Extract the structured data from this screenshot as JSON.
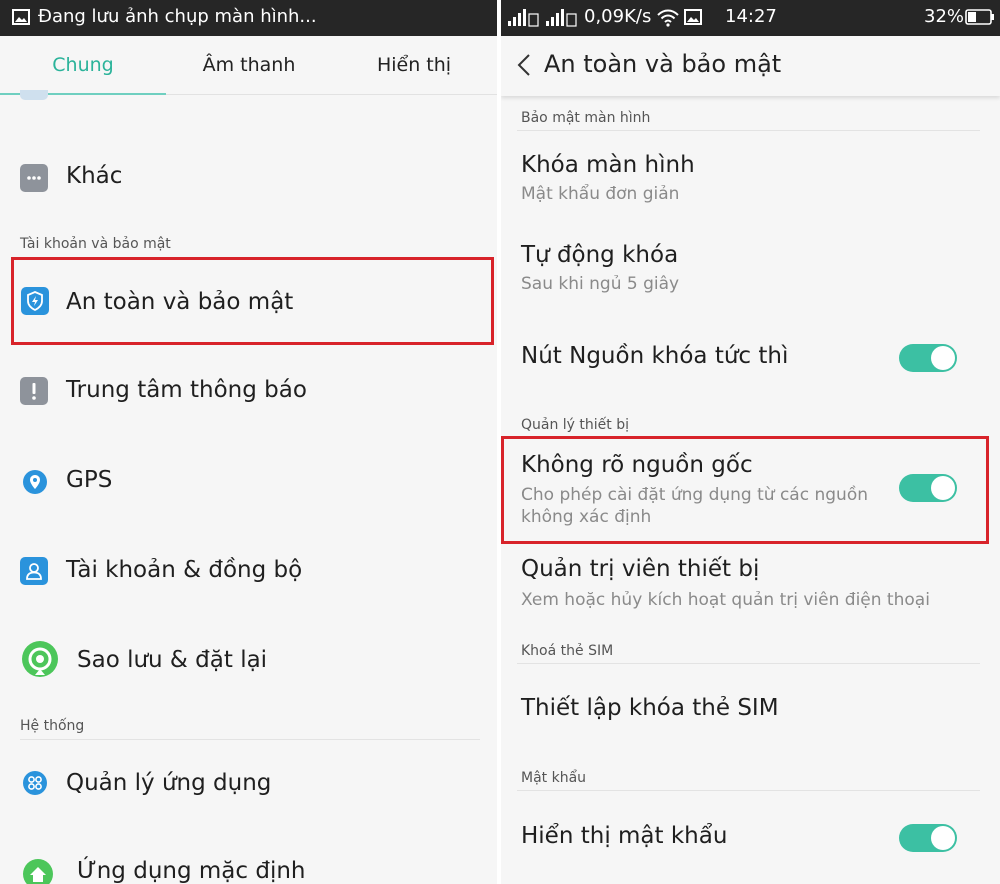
{
  "left_screen": {
    "status_title": "Đang lưu ảnh chụp màn hình...",
    "tabs": [
      "Chung",
      "Âm thanh",
      "Hiển thị"
    ],
    "items": {
      "other": "Khác",
      "security": "An toàn và bảo mật",
      "notification_center": "Trung tâm thông báo",
      "gps": "GPS",
      "accounts_sync": "Tài khoản & đồng bộ",
      "backup_reset": "Sao lưu & đặt lại",
      "app_manager": "Quản lý ứng dụng",
      "default_apps": "Ứng dụng mặc định"
    },
    "sections": {
      "account_security": "Tài khoản và bảo mật",
      "system": "Hệ thống"
    },
    "colors": {
      "accent": "#2bb39a",
      "highlight": "#d8232a"
    }
  },
  "right_screen": {
    "status": {
      "network_speed": "0,09K/s",
      "time": "14:27",
      "battery": "32%"
    },
    "header_title": "An toàn và bảo mật",
    "sections": {
      "screen_security": "Bảo mật màn hình",
      "device_management": "Quản lý thiết bị",
      "sim_lock": "Khoá thẻ SIM",
      "password": "Mật khẩu"
    },
    "rows": {
      "screen_lock": {
        "title": "Khóa màn hình",
        "subtitle": "Mật khẩu đơn giản"
      },
      "auto_lock": {
        "title": "Tự động khóa",
        "subtitle": "Sau khi ngủ 5 giây"
      },
      "power_lock": {
        "title": "Nút Nguồn khóa tức thì",
        "toggle": true
      },
      "unknown_sources": {
        "title": "Không rõ nguồn gốc",
        "subtitle_line1": "Cho phép cài đặt ứng dụng từ các nguồn",
        "subtitle_line2": "không xác định",
        "toggle": true
      },
      "device_admin": {
        "title": "Quản trị viên thiết bị",
        "subtitle": "Xem hoặc hủy kích hoạt quản trị viên điện thoại"
      },
      "sim_lock_setup": {
        "title": "Thiết lập khóa thẻ SIM"
      },
      "show_password": {
        "title": "Hiển thị mật khẩu",
        "toggle": true
      }
    },
    "colors": {
      "toggle_on": "#3cc0a3"
    }
  }
}
